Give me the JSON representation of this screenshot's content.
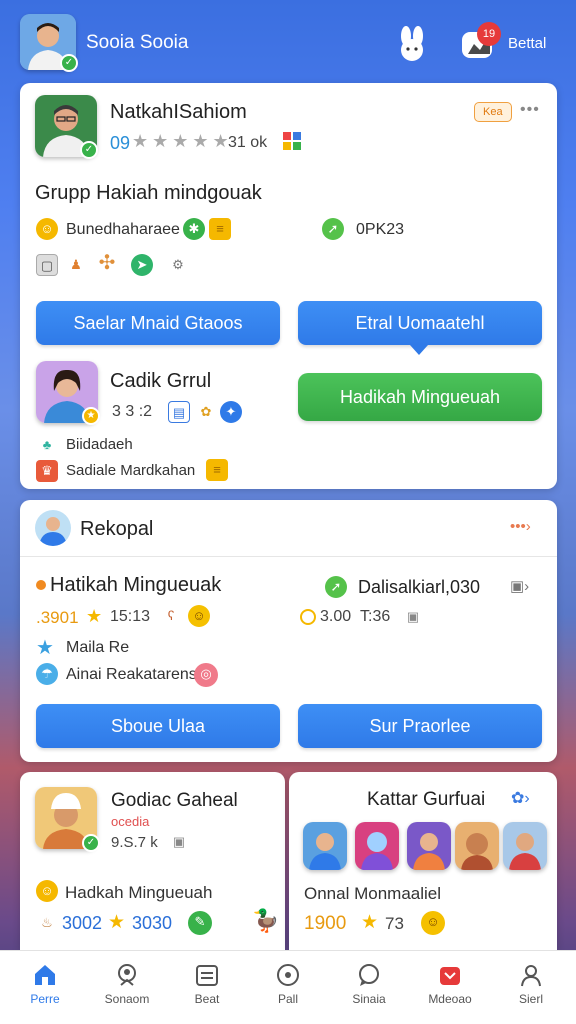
{
  "header": {
    "title": "Sooia Sooia",
    "right_label": "Bettal",
    "notification_count": "19"
  },
  "profile_card": {
    "name": "NatkahISahiom",
    "badge": "Kea",
    "stats_number": "09",
    "stats_suffix": "31 ok",
    "group_title": "Grupp Hakiah mindgouak",
    "line1_text": "Bunedhaharaee",
    "line1_right": "0PK23",
    "btn_left": "Saelar Mnaid Gtaoos",
    "btn_right": "Etral Uomaatehl",
    "sub_name": "Cadik Grrul",
    "sub_stat": "3 3 :2",
    "sub_line1": "Biidadaeh",
    "sub_line2": "Sadiale Mardkahan",
    "green_btn": "Hadikah Mingueuah"
  },
  "section2": {
    "title": "Rekopal",
    "left_title": "Hatikah Mingueuak",
    "left_score": ".3901",
    "left_time": "15:13",
    "right_title": "Dalisalkiarl,030",
    "right_score": "3.00",
    "right_time": "T:36",
    "row1": "Maila Re",
    "row2": "Ainai Reakatarens",
    "btn_left": "Sboue Ulaa",
    "btn_right": "Sur Praorlee"
  },
  "bottom_left": {
    "name": "Godiac Gaheal",
    "subtitle": "ocedia",
    "stat": "9.S.7 k",
    "line": "Hadkah Mingueuah",
    "score1": "3002",
    "score2": "3030"
  },
  "bottom_right": {
    "title": "Kattar Gurfuai",
    "line": "Onnal Monmaaliel",
    "score": "1900",
    "stat": "73"
  },
  "tabs": [
    {
      "label": "Perre",
      "icon": "home-icon",
      "active": true
    },
    {
      "label": "Sonaom",
      "icon": "person-badge-icon",
      "active": false
    },
    {
      "label": "Beat",
      "icon": "calendar-icon",
      "active": false
    },
    {
      "label": "Pall",
      "icon": "compass-icon",
      "active": false
    },
    {
      "label": "Sinaia",
      "icon": "chat-icon",
      "active": false
    },
    {
      "label": "Mdeoao",
      "icon": "notification-icon",
      "active": false
    },
    {
      "label": "Sierl",
      "icon": "profile-icon",
      "active": false
    }
  ],
  "colors": {
    "primary_blue": "#2f7ae8",
    "green": "#35a845",
    "star": "#f5b800"
  }
}
